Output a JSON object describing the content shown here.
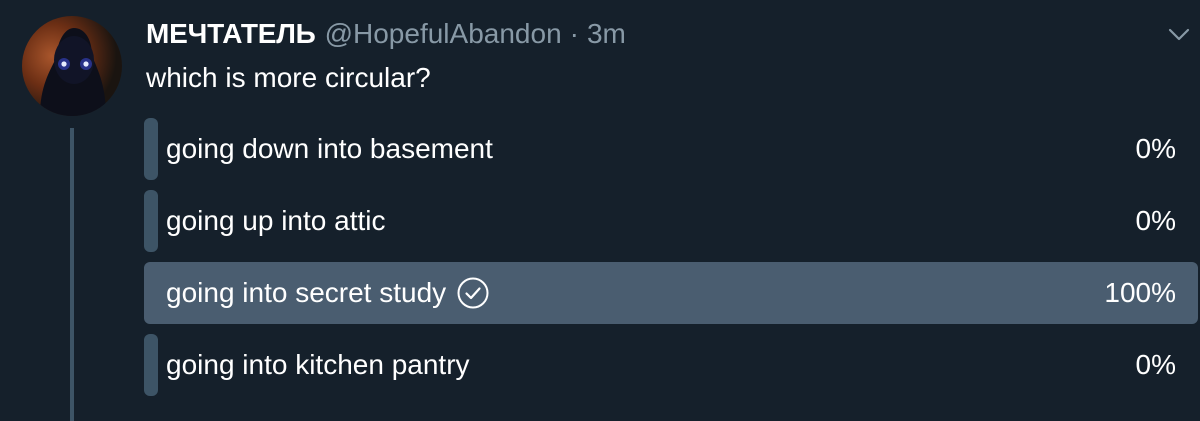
{
  "tweet": {
    "display_name": "МЕЧТАТЕЛЬ",
    "handle": "@HopefulAbandon",
    "separator": "·",
    "time": "3m",
    "text": "which is more circular?"
  },
  "poll": {
    "options": [
      {
        "label": "going down into basement",
        "percent": "0%",
        "fraction": 0,
        "winner": false
      },
      {
        "label": "going up into attic",
        "percent": "0%",
        "fraction": 0,
        "winner": false
      },
      {
        "label": "going into secret study",
        "percent": "100%",
        "fraction": 1,
        "winner": true
      },
      {
        "label": "going into kitchen pantry",
        "percent": "0%",
        "fraction": 0,
        "winner": false
      }
    ]
  },
  "icons": {
    "avatar": "profile-avatar",
    "menu": "chevron-down-icon",
    "winner": "check-circle-icon"
  },
  "colors": {
    "background": "#15202b",
    "bar": "#3d5466",
    "bar_winner": "#4a5d70",
    "text_secondary": "#8899a6"
  }
}
